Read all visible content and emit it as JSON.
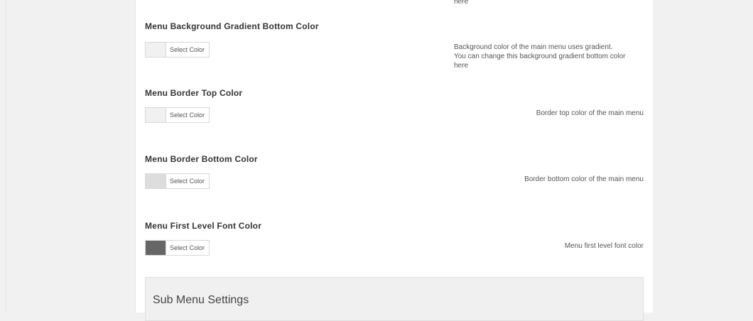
{
  "top_desc_fragment": "here",
  "options": [
    {
      "title": "Menu Background Gradient Bottom Color",
      "button_label": "Select Color",
      "swatch_color": "#f1f1f1",
      "description_lines": [
        "Background color of the main menu uses gradient.",
        "You can change this background gradient bottom color",
        "here"
      ]
    },
    {
      "title": "Menu Border Top Color",
      "button_label": "Select Color",
      "swatch_color": "#f1f1f1",
      "description": "Border top color of the main menu"
    },
    {
      "title": "Menu Border Bottom Color",
      "button_label": "Select Color",
      "swatch_color": "#dddddd",
      "description": "Border bottom color of the main menu"
    },
    {
      "title": "Menu First Level Font Color",
      "button_label": "Select Color",
      "swatch_color": "#666666",
      "description": "Menu first level font color"
    }
  ],
  "submenu_section": {
    "title": "Sub Menu Settings"
  }
}
